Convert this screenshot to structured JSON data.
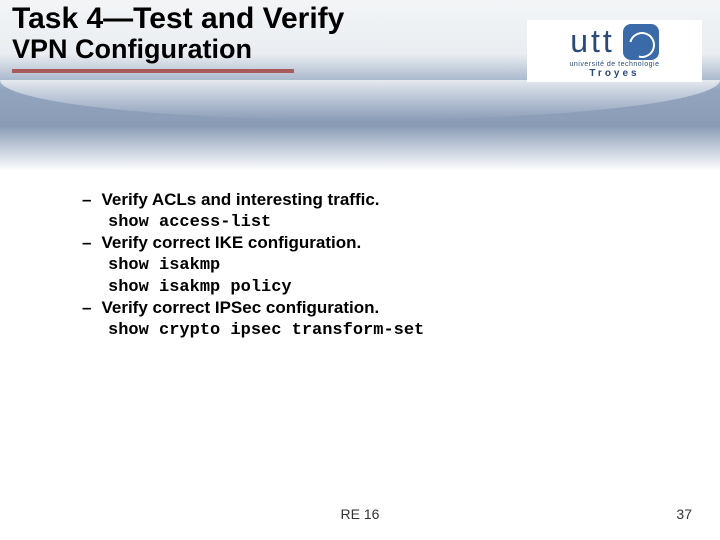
{
  "title": {
    "line1": "Task 4—Test and Verify",
    "line2": "VPN Configuration"
  },
  "logo": {
    "text": "utt",
    "subtitle": "université de technologie",
    "city": "Troyes"
  },
  "bullets": [
    {
      "label": "Verify ACLs and interesting traffic.",
      "commands": [
        "show access-list"
      ]
    },
    {
      "label": "Verify correct IKE configuration.",
      "commands": [
        "show isakmp",
        "show isakmp policy"
      ]
    },
    {
      "label": "Verify correct IPSec configuration.",
      "commands": [
        "show crypto ipsec transform-set"
      ]
    }
  ],
  "footer": {
    "code": "RE 16",
    "page": "37"
  }
}
